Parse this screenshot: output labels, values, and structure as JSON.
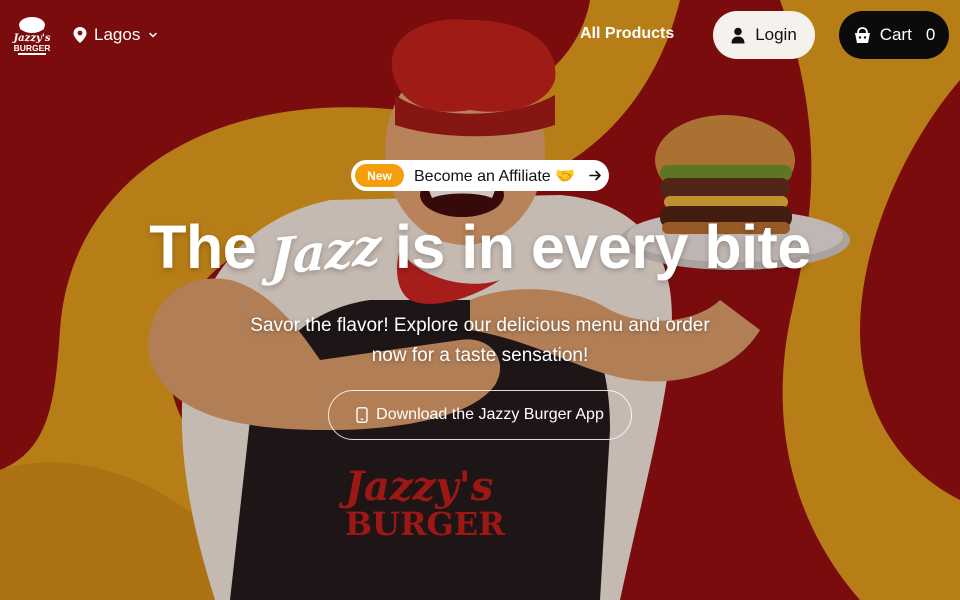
{
  "header": {
    "logo_text": "JAZZY'S BURGER",
    "location": "Lagos",
    "nav_all_products": "All Products",
    "login_label": "Login",
    "cart_label": "Cart",
    "cart_count": "0"
  },
  "hero": {
    "affiliate_badge": "New",
    "affiliate_text": "Become an Affiliate 🤝",
    "headline_before": "The",
    "headline_script": "Jazz",
    "headline_after": "is in every bite",
    "subtitle": "Savor the flavor! Explore our delicious menu and order now for a taste sensation!",
    "download_label": "Download the Jazzy Burger App",
    "apron_text_1": "Jazzy's",
    "apron_text_2": "BURGER"
  },
  "colors": {
    "background_red": "#8e0f10",
    "swoosh_yellow": "#d79a1e",
    "badge_orange": "#f59e0b",
    "cart_black": "#0b0b0b",
    "login_white": "#f5f2ee"
  },
  "icons": {
    "location": "map-pin-icon",
    "dropdown": "chevron-down-icon",
    "user": "user-icon",
    "cart": "basket-icon",
    "arrow": "arrow-right-icon",
    "phone": "smartphone-icon"
  }
}
